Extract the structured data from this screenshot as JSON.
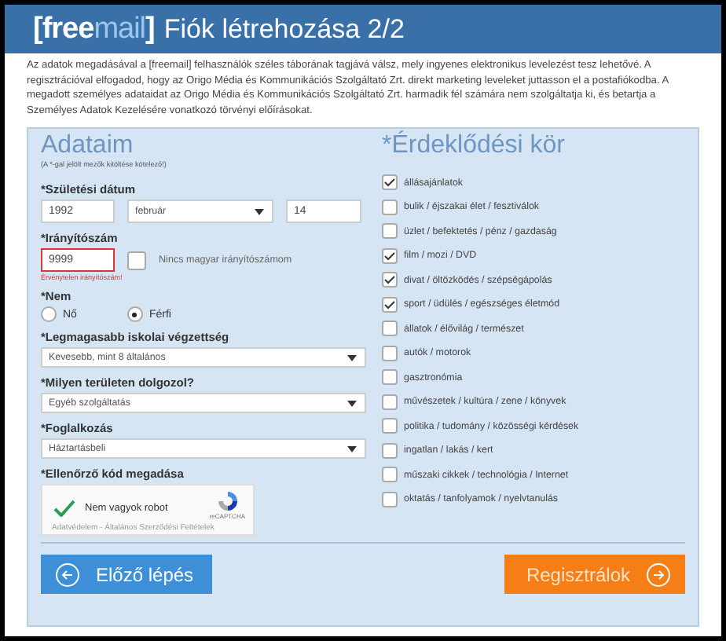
{
  "header": {
    "logo": [
      {
        "text": "[",
        "kind": "bracket"
      },
      {
        "text": "free",
        "kind": "strong"
      },
      {
        "text": "mail",
        "kind": "light"
      },
      {
        "text": "]",
        "kind": "bracket"
      }
    ],
    "title": "Fiók létrehozása 2/2"
  },
  "intro": "Az adatok megadásával a [freemail] felhasználók széles táborának tagjává válsz, mely ingyenes elektronikus levelezést tesz lehetővé. A regisztrációval elfogadod, hogy az Origo Média és Kommunikációs Szolgáltató Zrt. direkt marketing leveleket juttasson el a postafiókodba. A megadott személyes adataidat az Origo Média és Kommunikációs Szolgáltató Zrt. harmadik fél számára nem szolgáltatja ki, és betartja a Személyes Adatok Kezelésére vonatkozó törvényi előírásokat.",
  "personal": {
    "title": "Adataim",
    "note": "(A *-gal jelölt mezők kitöltése kötelező!)",
    "birth": {
      "label": "*Születési dátum",
      "year": "1992",
      "month": "február",
      "day": "14"
    },
    "zip": {
      "label": "*Irányítószám",
      "value": "9999",
      "invalid": true,
      "error": "Érvénytelen irányítószám!",
      "no_hu_zip": {
        "label": "Nincs magyar irányítószámom",
        "checked": false
      }
    },
    "gender": {
      "label": "*Nem",
      "options": [
        {
          "label": "Nő",
          "selected": false
        },
        {
          "label": "Férfi",
          "selected": true
        }
      ]
    },
    "selects": [
      {
        "label": "*Legmagasabb iskolai végzettség",
        "value": "Kevesebb, mint 8 általános"
      },
      {
        "label": "*Milyen területen dolgozol?",
        "value": "Egyéb szolgáltatás"
      },
      {
        "label": "*Foglalkozás",
        "value": "Háztartásbeli"
      }
    ],
    "captcha": {
      "label": "*Ellenőrző kód megadása",
      "text": "Nem vagyok robot",
      "checked": true,
      "brand": "reCAPTCHA",
      "links": "Adatvédelem - Általános Szerződési Feltételek"
    }
  },
  "interests": {
    "title": "*Érdeklődési kör",
    "items": [
      {
        "label": "állásajánlatok",
        "checked": true
      },
      {
        "label": "bulik / éjszakai élet / fesztiválok",
        "checked": false
      },
      {
        "label": "üzlet / befektetés / pénz / gazdaság",
        "checked": false
      },
      {
        "label": "film / mozi / DVD",
        "checked": true
      },
      {
        "label": "divat / öltözködés / szépségápolás",
        "checked": true
      },
      {
        "label": "sport / üdülés / egészséges életmód",
        "checked": true
      },
      {
        "label": "állatok / élővilág / természet",
        "checked": false
      },
      {
        "label": "autók / motorok",
        "checked": false
      },
      {
        "label": "gasztronómia",
        "checked": false
      },
      {
        "label": "művészetek / kultúra / zene / könyvek",
        "checked": false
      },
      {
        "label": "politika / tudomány / közösségi kérdések",
        "checked": false
      },
      {
        "label": "ingatlan / lakás / kert",
        "checked": false
      },
      {
        "label": "műszaki cikkek / technológia / Internet",
        "checked": false
      },
      {
        "label": "oktatás / tanfolyamok / nyelvtanulás",
        "checked": false
      }
    ]
  },
  "buttons": {
    "back": "Előző lépés",
    "next": "Regisztrálok"
  }
}
